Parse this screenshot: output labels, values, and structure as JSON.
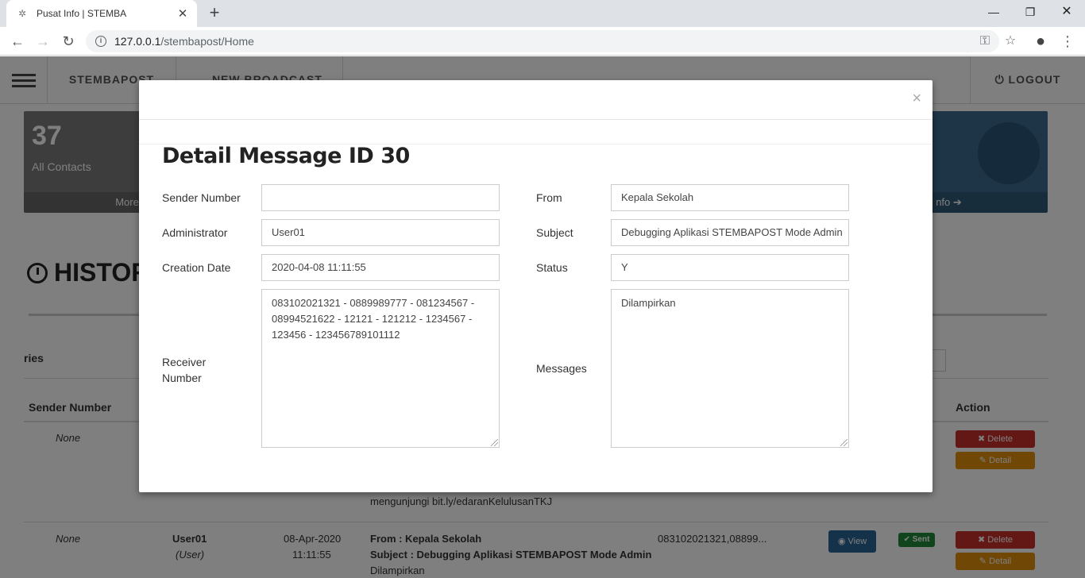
{
  "browser": {
    "tab_title": "Pusat Info | STEMBA",
    "url_host": "127.0.0.1",
    "url_path": "/stembapost/Home"
  },
  "nav": {
    "brand": "STEMBAPOST",
    "broadcast": "NEW BROADCAST",
    "logout": "LOGOUT"
  },
  "stats": {
    "contacts_count": "37",
    "contacts_label": "All Contacts",
    "contacts_footer": "More",
    "right_footer": "nfo"
  },
  "history": {
    "title": "HISTOR",
    "entries_label": "ries"
  },
  "table": {
    "headers": {
      "sender": "Sender Number",
      "action": "Action"
    },
    "rows": [
      {
        "sender": "None",
        "message_tail": "mengunjungi bit.ly/edaranKelulusanTKJ",
        "delete": "Delete",
        "detail": "Detail"
      },
      {
        "sender": "None",
        "admin": "User01",
        "admin_role": "(User)",
        "date": "08-Apr-2020",
        "time": "11:11:55",
        "from": "From : Kepala Sekolah",
        "subject": "Subject : Debugging Aplikasi STEMBAPOST Mode Admin",
        "message": "Dilampirkan",
        "receiver": "083102021321,08899...",
        "view": "View",
        "status": "Sent",
        "delete": "Delete",
        "detail": "Detail"
      }
    ]
  },
  "modal": {
    "title": "Detail Message ID 30",
    "close": "×",
    "labels": {
      "sender_number": "Sender Number",
      "administrator": "Administrator",
      "creation_date": "Creation Date",
      "receiver_number_line1": "Receiver",
      "receiver_number_line2": "Number",
      "from": "From",
      "subject": "Subject",
      "status": "Status",
      "messages": "Messages"
    },
    "values": {
      "sender_number": "",
      "administrator": "User01",
      "creation_date": "2020-04-08 11:11:55",
      "receiver_number_line1": "083102021321 - 0889989777 - 081234567 -",
      "receiver_number_line2": "08994521622 - 12121 - 121212 - 1234567 -",
      "receiver_number_line3": "123456 - 123456789101112",
      "from": "Kepala Sekolah",
      "subject": "Debugging Aplikasi STEMBAPOST Mode Admin",
      "status": "Y",
      "messages": "Dilampirkan"
    }
  }
}
